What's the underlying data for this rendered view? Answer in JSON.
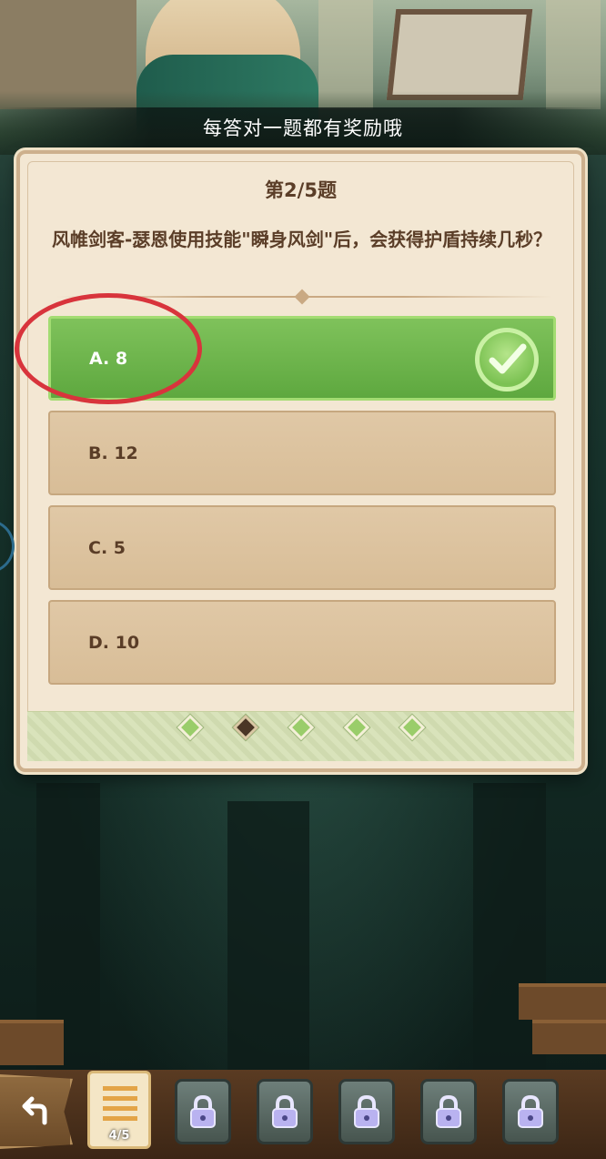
{
  "banner": {
    "text": "每答对一题都有奖励哦"
  },
  "quiz": {
    "question_number": "第2/5题",
    "question": "风帷剑客-瑟恩使用技能\"瞬身风剑\"后，会获得护盾持续几秒？",
    "options": [
      {
        "label": "A. 8",
        "state": "correct"
      },
      {
        "label": "B. 12",
        "state": "neutral"
      },
      {
        "label": "C. 5",
        "state": "neutral"
      },
      {
        "label": "D. 10",
        "state": "neutral"
      }
    ],
    "progress": {
      "total": 5,
      "current": 2
    }
  },
  "bottom_bar": {
    "back_icon": "return-arrow-icon",
    "current_slot_counter": "4/5",
    "locked_slots": 5
  },
  "colors": {
    "correct_green": "#6bb548",
    "annotation_red": "#d8343c",
    "card_bg": "#f3e7d3",
    "text_brown": "#5b3e28"
  }
}
